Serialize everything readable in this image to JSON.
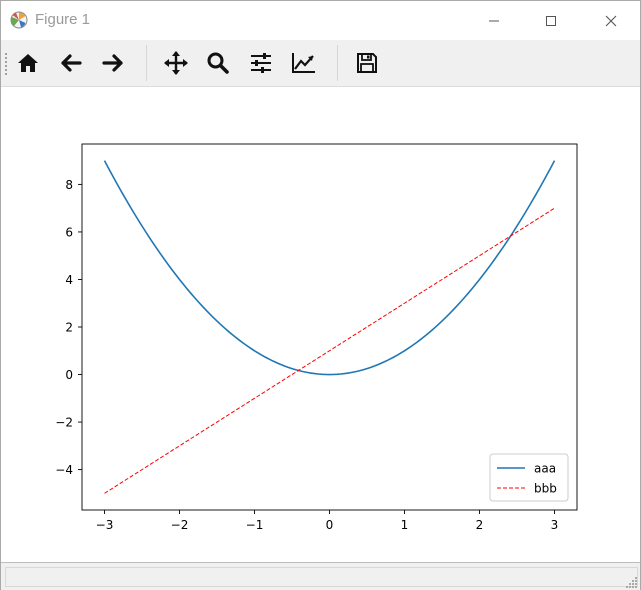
{
  "window": {
    "title": "Figure 1"
  },
  "toolbar": {
    "buttons": [
      {
        "name": "home-icon"
      },
      {
        "name": "back-arrow-icon"
      },
      {
        "name": "forward-arrow-icon"
      },
      {
        "name": "pan-move-icon"
      },
      {
        "name": "zoom-magnifier-icon"
      },
      {
        "name": "subplots-sliders-icon"
      },
      {
        "name": "edit-axes-icon"
      },
      {
        "name": "save-floppy-icon"
      }
    ]
  },
  "chart_data": {
    "type": "line",
    "title": "",
    "xlabel": "",
    "ylabel": "",
    "xlim": [
      -3.3,
      3.3
    ],
    "ylim": [
      -5.7,
      9.7
    ],
    "x_ticks": [
      -3,
      -2,
      -1,
      0,
      1,
      2,
      3
    ],
    "y_ticks": [
      -4,
      -2,
      0,
      2,
      4,
      6,
      8
    ],
    "grid": false,
    "legend": "lower-right",
    "series": [
      {
        "name": "aaa",
        "function": "y = x^2",
        "color": "#1f77b4",
        "linestyle": "solid",
        "x": [
          -3,
          -2.5,
          -2,
          -1.5,
          -1,
          -0.5,
          0,
          0.5,
          1,
          1.5,
          2,
          2.5,
          3
        ],
        "y": [
          9,
          6.25,
          4,
          2.25,
          1,
          0.25,
          0,
          0.25,
          1,
          2.25,
          4,
          6.25,
          9
        ]
      },
      {
        "name": "bbb",
        "function": "y = 2x + 1",
        "color": "#ff0000",
        "linestyle": "dashed",
        "x": [
          -3,
          3
        ],
        "y": [
          -5,
          7
        ]
      }
    ]
  }
}
